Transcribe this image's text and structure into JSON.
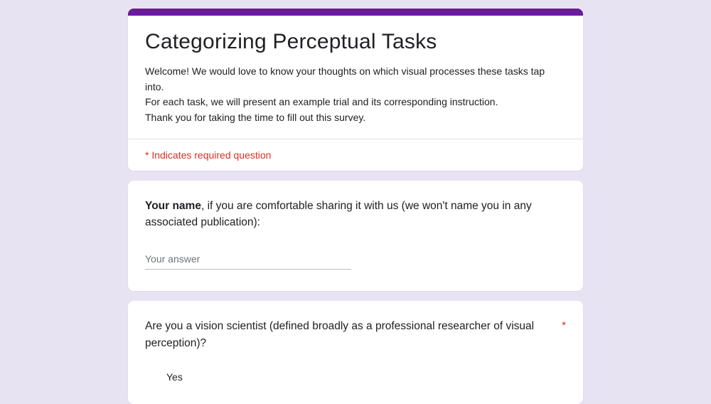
{
  "header": {
    "title": "Categorizing Perceptual Tasks",
    "description_line1": "Welcome! We would love to know your thoughts on which visual processes these tasks tap into.",
    "description_line2": "For each task, we will present an example trial and its corresponding instruction.",
    "description_line3": "Thank you for taking the time to fill out this survey.",
    "required_notice": "* Indicates required question"
  },
  "question1": {
    "label_bold": "Your name",
    "label_rest": ", if you are comfortable sharing it with us (we won't name you in any associated publication):",
    "placeholder": "Your answer"
  },
  "question2": {
    "text": "Are you a vision scientist (defined broadly as a professional researcher of visual perception)?",
    "required_marker": "*",
    "option1": "Yes"
  }
}
